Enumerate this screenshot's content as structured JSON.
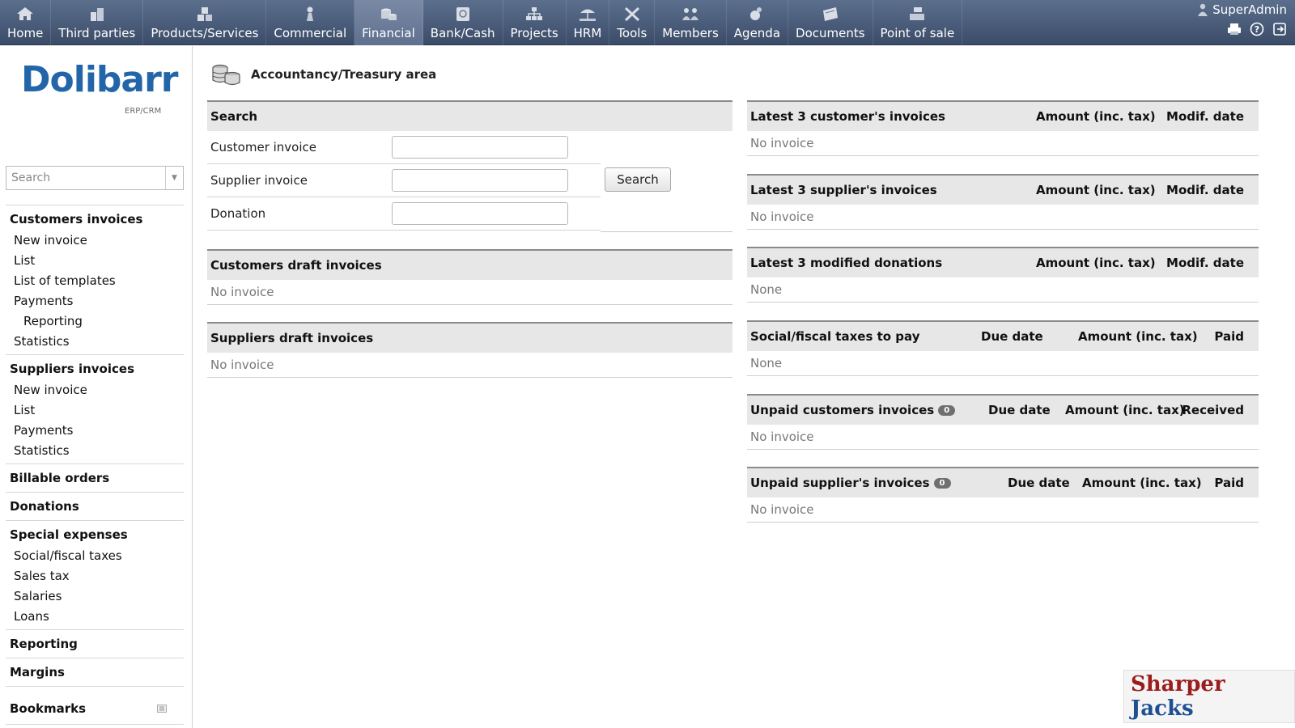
{
  "topmenu": {
    "items": [
      {
        "label": "Home",
        "icon": "home-icon"
      },
      {
        "label": "Third parties",
        "icon": "building-icon"
      },
      {
        "label": "Products/Services",
        "icon": "boxes-icon"
      },
      {
        "label": "Commercial",
        "icon": "briefcase-icon"
      },
      {
        "label": "Financial",
        "icon": "coins-icon",
        "active": true
      },
      {
        "label": "Bank/Cash",
        "icon": "safe-icon"
      },
      {
        "label": "Projects",
        "icon": "hierarchy-icon"
      },
      {
        "label": "HRM",
        "icon": "beach-icon"
      },
      {
        "label": "Tools",
        "icon": "tools-icon"
      },
      {
        "label": "Members",
        "icon": "members-icon"
      },
      {
        "label": "Agenda",
        "icon": "agenda-icon"
      },
      {
        "label": "Documents",
        "icon": "documents-icon"
      },
      {
        "label": "Point of sale",
        "icon": "cash-register-icon"
      }
    ],
    "user": "SuperAdmin",
    "tools": [
      "print-icon",
      "help-icon",
      "logout-icon"
    ]
  },
  "logo": {
    "text": "Dolibarr",
    "sub": "ERP/CRM"
  },
  "sidebar": {
    "search_placeholder": "Search",
    "sections": [
      {
        "title": "Customers invoices",
        "links": [
          {
            "label": "New invoice"
          },
          {
            "label": "List"
          },
          {
            "label": "List of templates"
          },
          {
            "label": "Payments"
          },
          {
            "label": "Reporting",
            "level": 2
          },
          {
            "label": "Statistics"
          }
        ]
      },
      {
        "title": "Suppliers invoices",
        "links": [
          {
            "label": "New invoice"
          },
          {
            "label": "List"
          },
          {
            "label": "Payments"
          },
          {
            "label": "Statistics"
          }
        ]
      },
      {
        "title": "Billable orders",
        "links": []
      },
      {
        "title": "Donations",
        "links": []
      },
      {
        "title": "Special expenses",
        "links": [
          {
            "label": "Social/fiscal taxes"
          },
          {
            "label": "Sales tax"
          },
          {
            "label": "Salaries"
          },
          {
            "label": "Loans"
          }
        ]
      },
      {
        "title": "Reporting",
        "links": []
      },
      {
        "title": "Margins",
        "links": []
      }
    ],
    "bookmarks": "Bookmarks"
  },
  "page": {
    "title": "Accountancy/Treasury area"
  },
  "search_box": {
    "title": "Search",
    "fields": [
      "Customer invoice",
      "Supplier invoice",
      "Donation"
    ],
    "button": "Search"
  },
  "left_boxes": {
    "customers_draft": {
      "title": "Customers draft invoices",
      "empty": "No invoice"
    },
    "suppliers_draft": {
      "title": "Suppliers draft invoices",
      "empty": "No invoice"
    }
  },
  "right_boxes": {
    "latest_customer": {
      "title": "Latest 3 customer's invoices",
      "cols": [
        "Amount (inc. tax)",
        "Modif. date"
      ],
      "empty": "No invoice"
    },
    "latest_supplier": {
      "title": "Latest 3 supplier's invoices",
      "cols": [
        "Amount (inc. tax)",
        "Modif. date"
      ],
      "empty": "No invoice"
    },
    "latest_donations": {
      "title": "Latest 3 modified donations",
      "cols": [
        "Amount (inc. tax)",
        "Modif. date"
      ],
      "empty": "None"
    },
    "social_taxes": {
      "title": "Social/fiscal taxes to pay",
      "cols": [
        "Due date",
        "Amount (inc. tax)",
        "Paid"
      ],
      "empty": "None"
    },
    "unpaid_customers": {
      "title": "Unpaid customers invoices",
      "badge": "0",
      "cols": [
        "Due date",
        "Amount (inc. tax)",
        "Received"
      ],
      "empty": "No invoice"
    },
    "unpaid_suppliers": {
      "title": "Unpaid supplier's invoices",
      "badge": "0",
      "cols": [
        "Due date",
        "Amount (inc. tax)",
        "Paid"
      ],
      "empty": "No invoice"
    }
  },
  "watermark": {
    "part1": "Sharper",
    "part2": "Jacks"
  }
}
